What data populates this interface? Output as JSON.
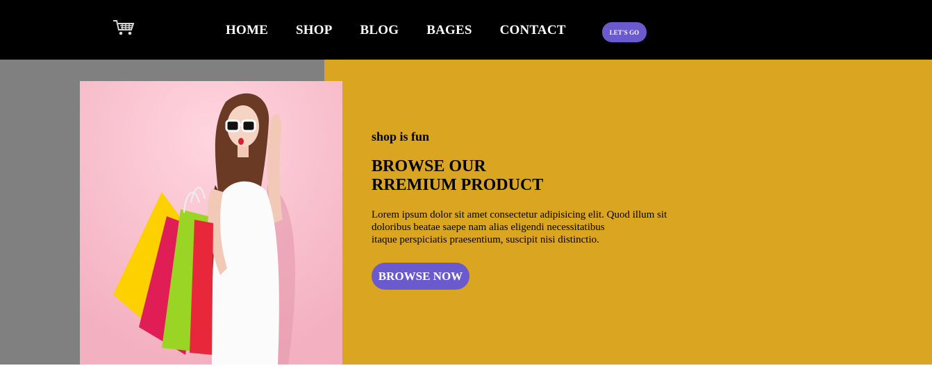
{
  "nav": {
    "logo_icon": "shopping-cart-icon",
    "items": [
      {
        "label": "HOME"
      },
      {
        "label": "SHOP"
      },
      {
        "label": "BLOG"
      },
      {
        "label": "BAGES"
      },
      {
        "label": "CONTACT"
      }
    ],
    "cta_label": "LET'S GO"
  },
  "hero": {
    "eyebrow": "shop is fun",
    "headline_line1": "BROWSE OUR",
    "headline_line2": "RREMIUM PRODUCT",
    "body_line1": "Lorem ipsum dolor sit amet consectetur adipisicing elit. Quod illum sit",
    "body_line2": "doloribus beatae saepe nam alias eligendi necessitatibus",
    "body_line3": "itaque perspiciatis praesentium, suscipit nisi distinctio.",
    "button_label": "BROWSE NOW"
  },
  "colors": {
    "nav_background": "#000000",
    "left_panel": "#808080",
    "right_panel": "#daa520",
    "accent": "#6a5acd",
    "photo_background": "#fbc7d4"
  }
}
